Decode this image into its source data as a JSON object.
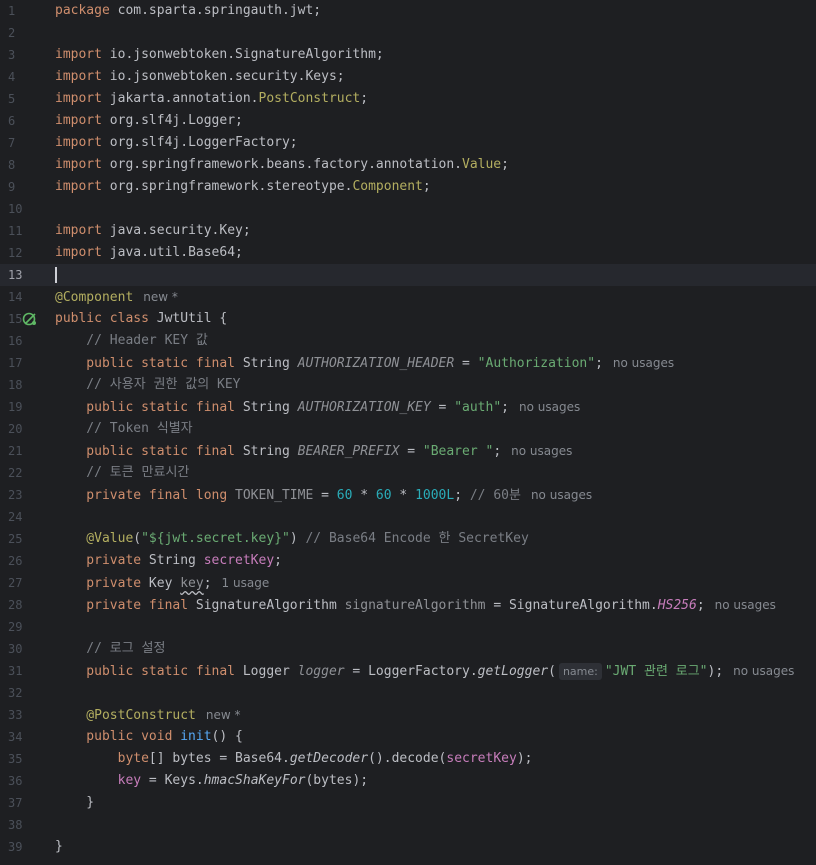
{
  "lines": [
    {
      "n": "1",
      "tokens": [
        {
          "t": "package ",
          "c": "kw"
        },
        {
          "t": "com.sparta.springauth.jwt;",
          "c": ""
        }
      ]
    },
    {
      "n": "2",
      "tokens": []
    },
    {
      "n": "3",
      "tokens": [
        {
          "t": "import ",
          "c": "kw"
        },
        {
          "t": "io.jsonwebtoken.SignatureAlgorithm;",
          "c": ""
        }
      ]
    },
    {
      "n": "4",
      "tokens": [
        {
          "t": "import ",
          "c": "kw"
        },
        {
          "t": "io.jsonwebtoken.security.Keys;",
          "c": ""
        }
      ]
    },
    {
      "n": "5",
      "tokens": [
        {
          "t": "import ",
          "c": "kw"
        },
        {
          "t": "jakarta.annotation.",
          "c": ""
        },
        {
          "t": "PostConstruct",
          "c": "ann"
        },
        {
          "t": ";",
          "c": ""
        }
      ]
    },
    {
      "n": "6",
      "tokens": [
        {
          "t": "import ",
          "c": "kw"
        },
        {
          "t": "org.slf4j.Logger;",
          "c": ""
        }
      ]
    },
    {
      "n": "7",
      "tokens": [
        {
          "t": "import ",
          "c": "kw"
        },
        {
          "t": "org.slf4j.LoggerFactory;",
          "c": ""
        }
      ]
    },
    {
      "n": "8",
      "tokens": [
        {
          "t": "import ",
          "c": "kw"
        },
        {
          "t": "org.springframework.beans.factory.annotation.",
          "c": ""
        },
        {
          "t": "Value",
          "c": "ann"
        },
        {
          "t": ";",
          "c": ""
        }
      ]
    },
    {
      "n": "9",
      "tokens": [
        {
          "t": "import ",
          "c": "kw"
        },
        {
          "t": "org.springframework.stereotype.",
          "c": ""
        },
        {
          "t": "Component",
          "c": "ann"
        },
        {
          "t": ";",
          "c": ""
        }
      ]
    },
    {
      "n": "10",
      "tokens": []
    },
    {
      "n": "11",
      "tokens": [
        {
          "t": "import ",
          "c": "kw"
        },
        {
          "t": "java.security.Key;",
          "c": ""
        }
      ]
    },
    {
      "n": "12",
      "tokens": [
        {
          "t": "import ",
          "c": "kw"
        },
        {
          "t": "java.util.Base64;",
          "c": ""
        }
      ]
    },
    {
      "n": "13",
      "tokens": [],
      "current": true,
      "caret": true
    },
    {
      "n": "14",
      "tokens": [
        {
          "t": "@Component",
          "c": "ann"
        },
        {
          "t": "new *",
          "c": "hint"
        }
      ]
    },
    {
      "n": "15",
      "icon": "bean-icon",
      "tokens": [
        {
          "t": "public ",
          "c": "kw"
        },
        {
          "t": "class ",
          "c": "kw"
        },
        {
          "t": "JwtUtil {",
          "c": ""
        }
      ]
    },
    {
      "n": "16",
      "tokens": [
        {
          "t": "    // Header KEY 값",
          "c": "cmt"
        }
      ]
    },
    {
      "n": "17",
      "tokens": [
        {
          "t": "    public static final ",
          "c": "kw"
        },
        {
          "t": "String ",
          "c": ""
        },
        {
          "t": "AUTHORIZATION_HEADER",
          "c": "unused-static"
        },
        {
          "t": " = ",
          "c": ""
        },
        {
          "t": "\"Authorization\"",
          "c": "str"
        },
        {
          "t": ";",
          "c": ""
        },
        {
          "t": "no usages",
          "c": "hint"
        }
      ]
    },
    {
      "n": "18",
      "tokens": [
        {
          "t": "    // 사용자 권한 값의 KEY",
          "c": "cmt"
        }
      ]
    },
    {
      "n": "19",
      "tokens": [
        {
          "t": "    public static final ",
          "c": "kw"
        },
        {
          "t": "String ",
          "c": ""
        },
        {
          "t": "AUTHORIZATION_KEY",
          "c": "unused-static"
        },
        {
          "t": " = ",
          "c": ""
        },
        {
          "t": "\"auth\"",
          "c": "str"
        },
        {
          "t": ";",
          "c": ""
        },
        {
          "t": "no usages",
          "c": "hint"
        }
      ]
    },
    {
      "n": "20",
      "tokens": [
        {
          "t": "    // Token 식별자",
          "c": "cmt"
        }
      ]
    },
    {
      "n": "21",
      "tokens": [
        {
          "t": "    public static final ",
          "c": "kw"
        },
        {
          "t": "String ",
          "c": ""
        },
        {
          "t": "BEARER_PREFIX",
          "c": "unused-static"
        },
        {
          "t": " = ",
          "c": ""
        },
        {
          "t": "\"Bearer \"",
          "c": "str"
        },
        {
          "t": ";",
          "c": ""
        },
        {
          "t": "no usages",
          "c": "hint"
        }
      ]
    },
    {
      "n": "22",
      "tokens": [
        {
          "t": "    // 토큰 만료시간",
          "c": "cmt"
        }
      ]
    },
    {
      "n": "23",
      "tokens": [
        {
          "t": "    private final long ",
          "c": "kw"
        },
        {
          "t": "TOKEN_TIME",
          "c": "unused"
        },
        {
          "t": " = ",
          "c": ""
        },
        {
          "t": "60",
          "c": "num"
        },
        {
          "t": " * ",
          "c": ""
        },
        {
          "t": "60",
          "c": "num"
        },
        {
          "t": " * ",
          "c": ""
        },
        {
          "t": "1000L",
          "c": "num"
        },
        {
          "t": "; ",
          "c": ""
        },
        {
          "t": "// 60분",
          "c": "cmt"
        },
        {
          "t": "no usages",
          "c": "hint"
        }
      ]
    },
    {
      "n": "24",
      "tokens": []
    },
    {
      "n": "25",
      "tokens": [
        {
          "t": "    @Value",
          "c": "ann"
        },
        {
          "t": "(",
          "c": ""
        },
        {
          "t": "\"${",
          "c": "str"
        },
        {
          "t": "jwt.secret.key",
          "c": "str"
        },
        {
          "t": "}\"",
          "c": "str"
        },
        {
          "t": ") ",
          "c": ""
        },
        {
          "t": "// Base64 Encode 한 SecretKey",
          "c": "cmt"
        }
      ]
    },
    {
      "n": "26",
      "tokens": [
        {
          "t": "    private ",
          "c": "kw"
        },
        {
          "t": "String ",
          "c": ""
        },
        {
          "t": "secretKey",
          "c": "field"
        },
        {
          "t": ";",
          "c": ""
        }
      ]
    },
    {
      "n": "27",
      "tokens": [
        {
          "t": "    private ",
          "c": "kw"
        },
        {
          "t": "Key ",
          "c": ""
        },
        {
          "t": "key",
          "c": "unused wavy"
        },
        {
          "t": ";",
          "c": ""
        },
        {
          "t": "1 usage",
          "c": "hint"
        }
      ]
    },
    {
      "n": "28",
      "tokens": [
        {
          "t": "    private final ",
          "c": "kw"
        },
        {
          "t": "SignatureAlgorithm ",
          "c": ""
        },
        {
          "t": "signatureAlgorithm",
          "c": "unused"
        },
        {
          "t": " = SignatureAlgorithm.",
          "c": ""
        },
        {
          "t": "HS256",
          "c": "sfield"
        },
        {
          "t": ";",
          "c": ""
        },
        {
          "t": "no usages",
          "c": "hint"
        }
      ]
    },
    {
      "n": "29",
      "tokens": []
    },
    {
      "n": "30",
      "tokens": [
        {
          "t": "    // 로그 설정",
          "c": "cmt"
        }
      ]
    },
    {
      "n": "31",
      "tokens": [
        {
          "t": "    public static final ",
          "c": "kw"
        },
        {
          "t": "Logger ",
          "c": ""
        },
        {
          "t": "logger",
          "c": "unused-static"
        },
        {
          "t": " = LoggerFactory.",
          "c": ""
        },
        {
          "t": "getLogger",
          "c": "smethod"
        },
        {
          "t": "(",
          "c": ""
        },
        {
          "t": "name:",
          "c": "param-hint"
        },
        {
          "t": "\"JWT 관련 로그\"",
          "c": "str"
        },
        {
          "t": ");",
          "c": ""
        },
        {
          "t": "no usages",
          "c": "hint"
        }
      ]
    },
    {
      "n": "32",
      "tokens": []
    },
    {
      "n": "33",
      "tokens": [
        {
          "t": "    @PostConstruct",
          "c": "ann"
        },
        {
          "t": "new *",
          "c": "hint"
        }
      ]
    },
    {
      "n": "34",
      "tokens": [
        {
          "t": "    public void ",
          "c": "kw"
        },
        {
          "t": "init",
          "c": "mdecl"
        },
        {
          "t": "() {",
          "c": ""
        }
      ]
    },
    {
      "n": "35",
      "tokens": [
        {
          "t": "        byte",
          "c": "kw"
        },
        {
          "t": "[] bytes = Base64.",
          "c": ""
        },
        {
          "t": "getDecoder",
          "c": "smethod"
        },
        {
          "t": "().decode(",
          "c": ""
        },
        {
          "t": "secretKey",
          "c": "field"
        },
        {
          "t": ");",
          "c": ""
        }
      ]
    },
    {
      "n": "36",
      "tokens": [
        {
          "t": "        ",
          "c": ""
        },
        {
          "t": "key",
          "c": "field"
        },
        {
          "t": " = Keys.",
          "c": ""
        },
        {
          "t": "hmacShaKeyFor",
          "c": "smethod"
        },
        {
          "t": "(bytes);",
          "c": ""
        }
      ]
    },
    {
      "n": "37",
      "tokens": [
        {
          "t": "    }",
          "c": ""
        }
      ]
    },
    {
      "n": "38",
      "tokens": []
    },
    {
      "n": "39",
      "tokens": [
        {
          "t": "}",
          "c": ""
        }
      ]
    }
  ]
}
